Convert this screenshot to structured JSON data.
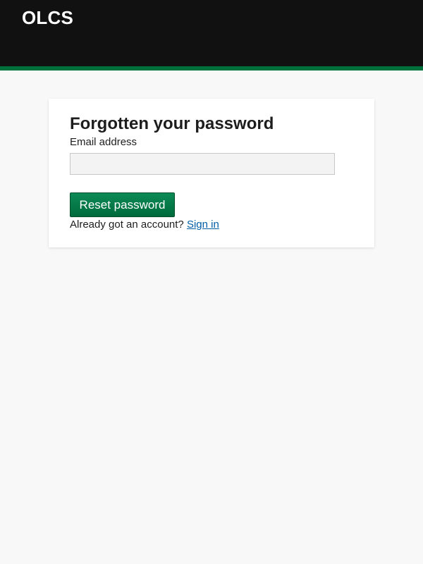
{
  "header": {
    "brand": "OLCS"
  },
  "form": {
    "title": "Forgotten your password",
    "email_label": "Email address",
    "email_value": "",
    "email_placeholder": "",
    "submit_label": "Reset password",
    "account_prompt": "Already got an account?",
    "signin_link": "Sign in"
  },
  "colors": {
    "header_bg": "#111111",
    "accent_bar": "#00703c",
    "button_bg": "#00703c",
    "link": "#005ea5",
    "page_bg": "#f8f8f8"
  }
}
